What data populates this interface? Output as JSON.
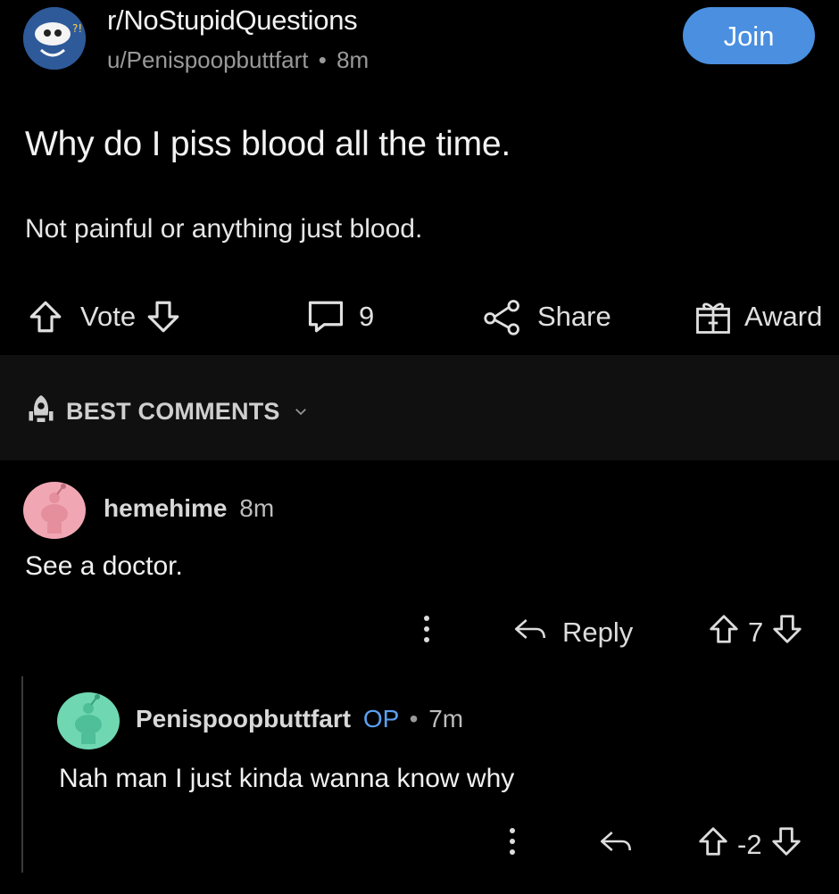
{
  "post": {
    "subreddit": "r/NoStupidQuestions",
    "author": "u/Penispoopbuttfart",
    "dot": "•",
    "time": "8m",
    "join_label": "Join",
    "title": "Why do I piss blood all the time.",
    "body": "Not painful or anything just blood.",
    "vote_label": "Vote",
    "comment_count": "9",
    "share_label": "Share",
    "award_label": "Award"
  },
  "sort": {
    "label": "BEST COMMENTS"
  },
  "comments": [
    {
      "author": "hemehime",
      "time": "8m",
      "body": "See a doctor.",
      "reply_label": "Reply",
      "score": "7",
      "avatar_color": "#f1a7b3"
    },
    {
      "author": "Penispoopbuttfart",
      "op_label": "OP",
      "dot": "•",
      "time": "7m",
      "body": "Nah man I just kinda wanna know why",
      "score": "-2",
      "avatar_color": "#6fd8b3"
    }
  ],
  "colors": {
    "background": "#000000",
    "join_button": "#4a8fe0",
    "op_badge": "#5aa0f0",
    "section_band": "#101010"
  },
  "icons": [
    "subreddit-avatar",
    "upvote-arrow-icon",
    "downvote-arrow-icon",
    "comment-bubble-icon",
    "share-icon",
    "gift-award-icon",
    "rocket-icon",
    "chevron-down-icon",
    "overflow-dots-icon",
    "reply-arrow-icon",
    "snoo-avatar"
  ]
}
